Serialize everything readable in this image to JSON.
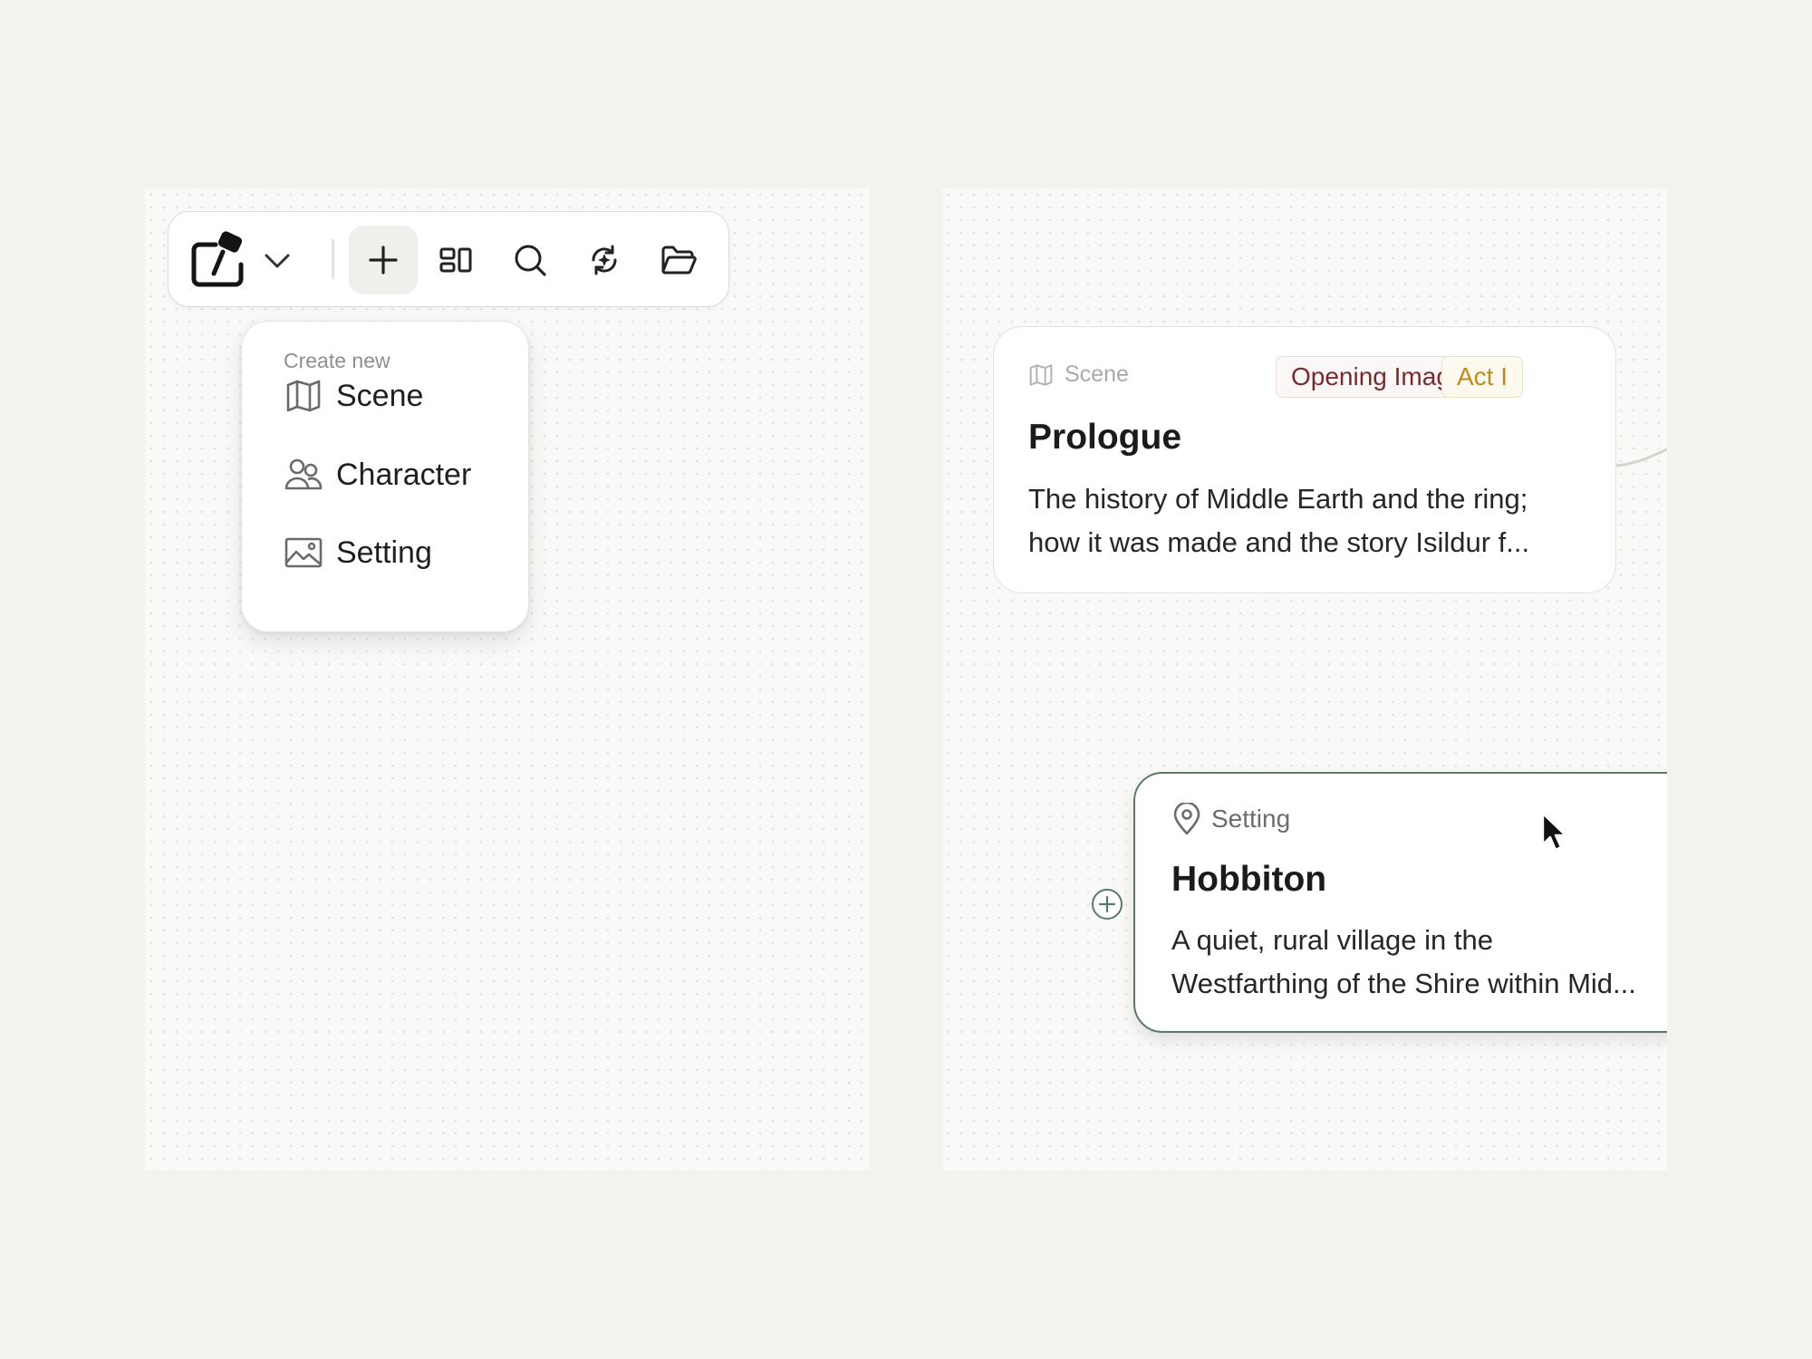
{
  "toolbar": {
    "logo_icon": "pen-tablet-logo-icon",
    "dropdown_icon": "chevron-down-icon",
    "buttons": [
      {
        "icon": "plus-icon",
        "active": true
      },
      {
        "icon": "layout-icon"
      },
      {
        "icon": "search-icon"
      },
      {
        "icon": "magic-refresh-icon"
      },
      {
        "icon": "folder-icon"
      }
    ]
  },
  "create_menu": {
    "title": "Create new",
    "items": [
      {
        "label": "Scene",
        "icon": "map-icon"
      },
      {
        "label": "Character",
        "icon": "users-icon"
      },
      {
        "label": "Setting",
        "icon": "image-icon"
      }
    ]
  },
  "cards": {
    "prologue": {
      "type_label": "Scene",
      "type_icon": "map-icon",
      "tags": [
        "Opening Image",
        "Act I"
      ],
      "title": "Prologue",
      "description": "The history of Middle Earth and the ring;\nhow it was made and the story Isildur f..."
    },
    "hobbiton": {
      "type_label": "Setting",
      "type_icon": "map-pin-icon",
      "title": "Hobbiton",
      "description": "A quiet, rural village in the\nWestfarthing of the Shire within Mid..."
    }
  },
  "colors": {
    "background": "#f2f2ef",
    "canvas": "#f9f9f7",
    "selected_border": "#5a7a69",
    "tag_opening_text": "#7a2a2a",
    "tag_act_text": "#c08a1f"
  }
}
